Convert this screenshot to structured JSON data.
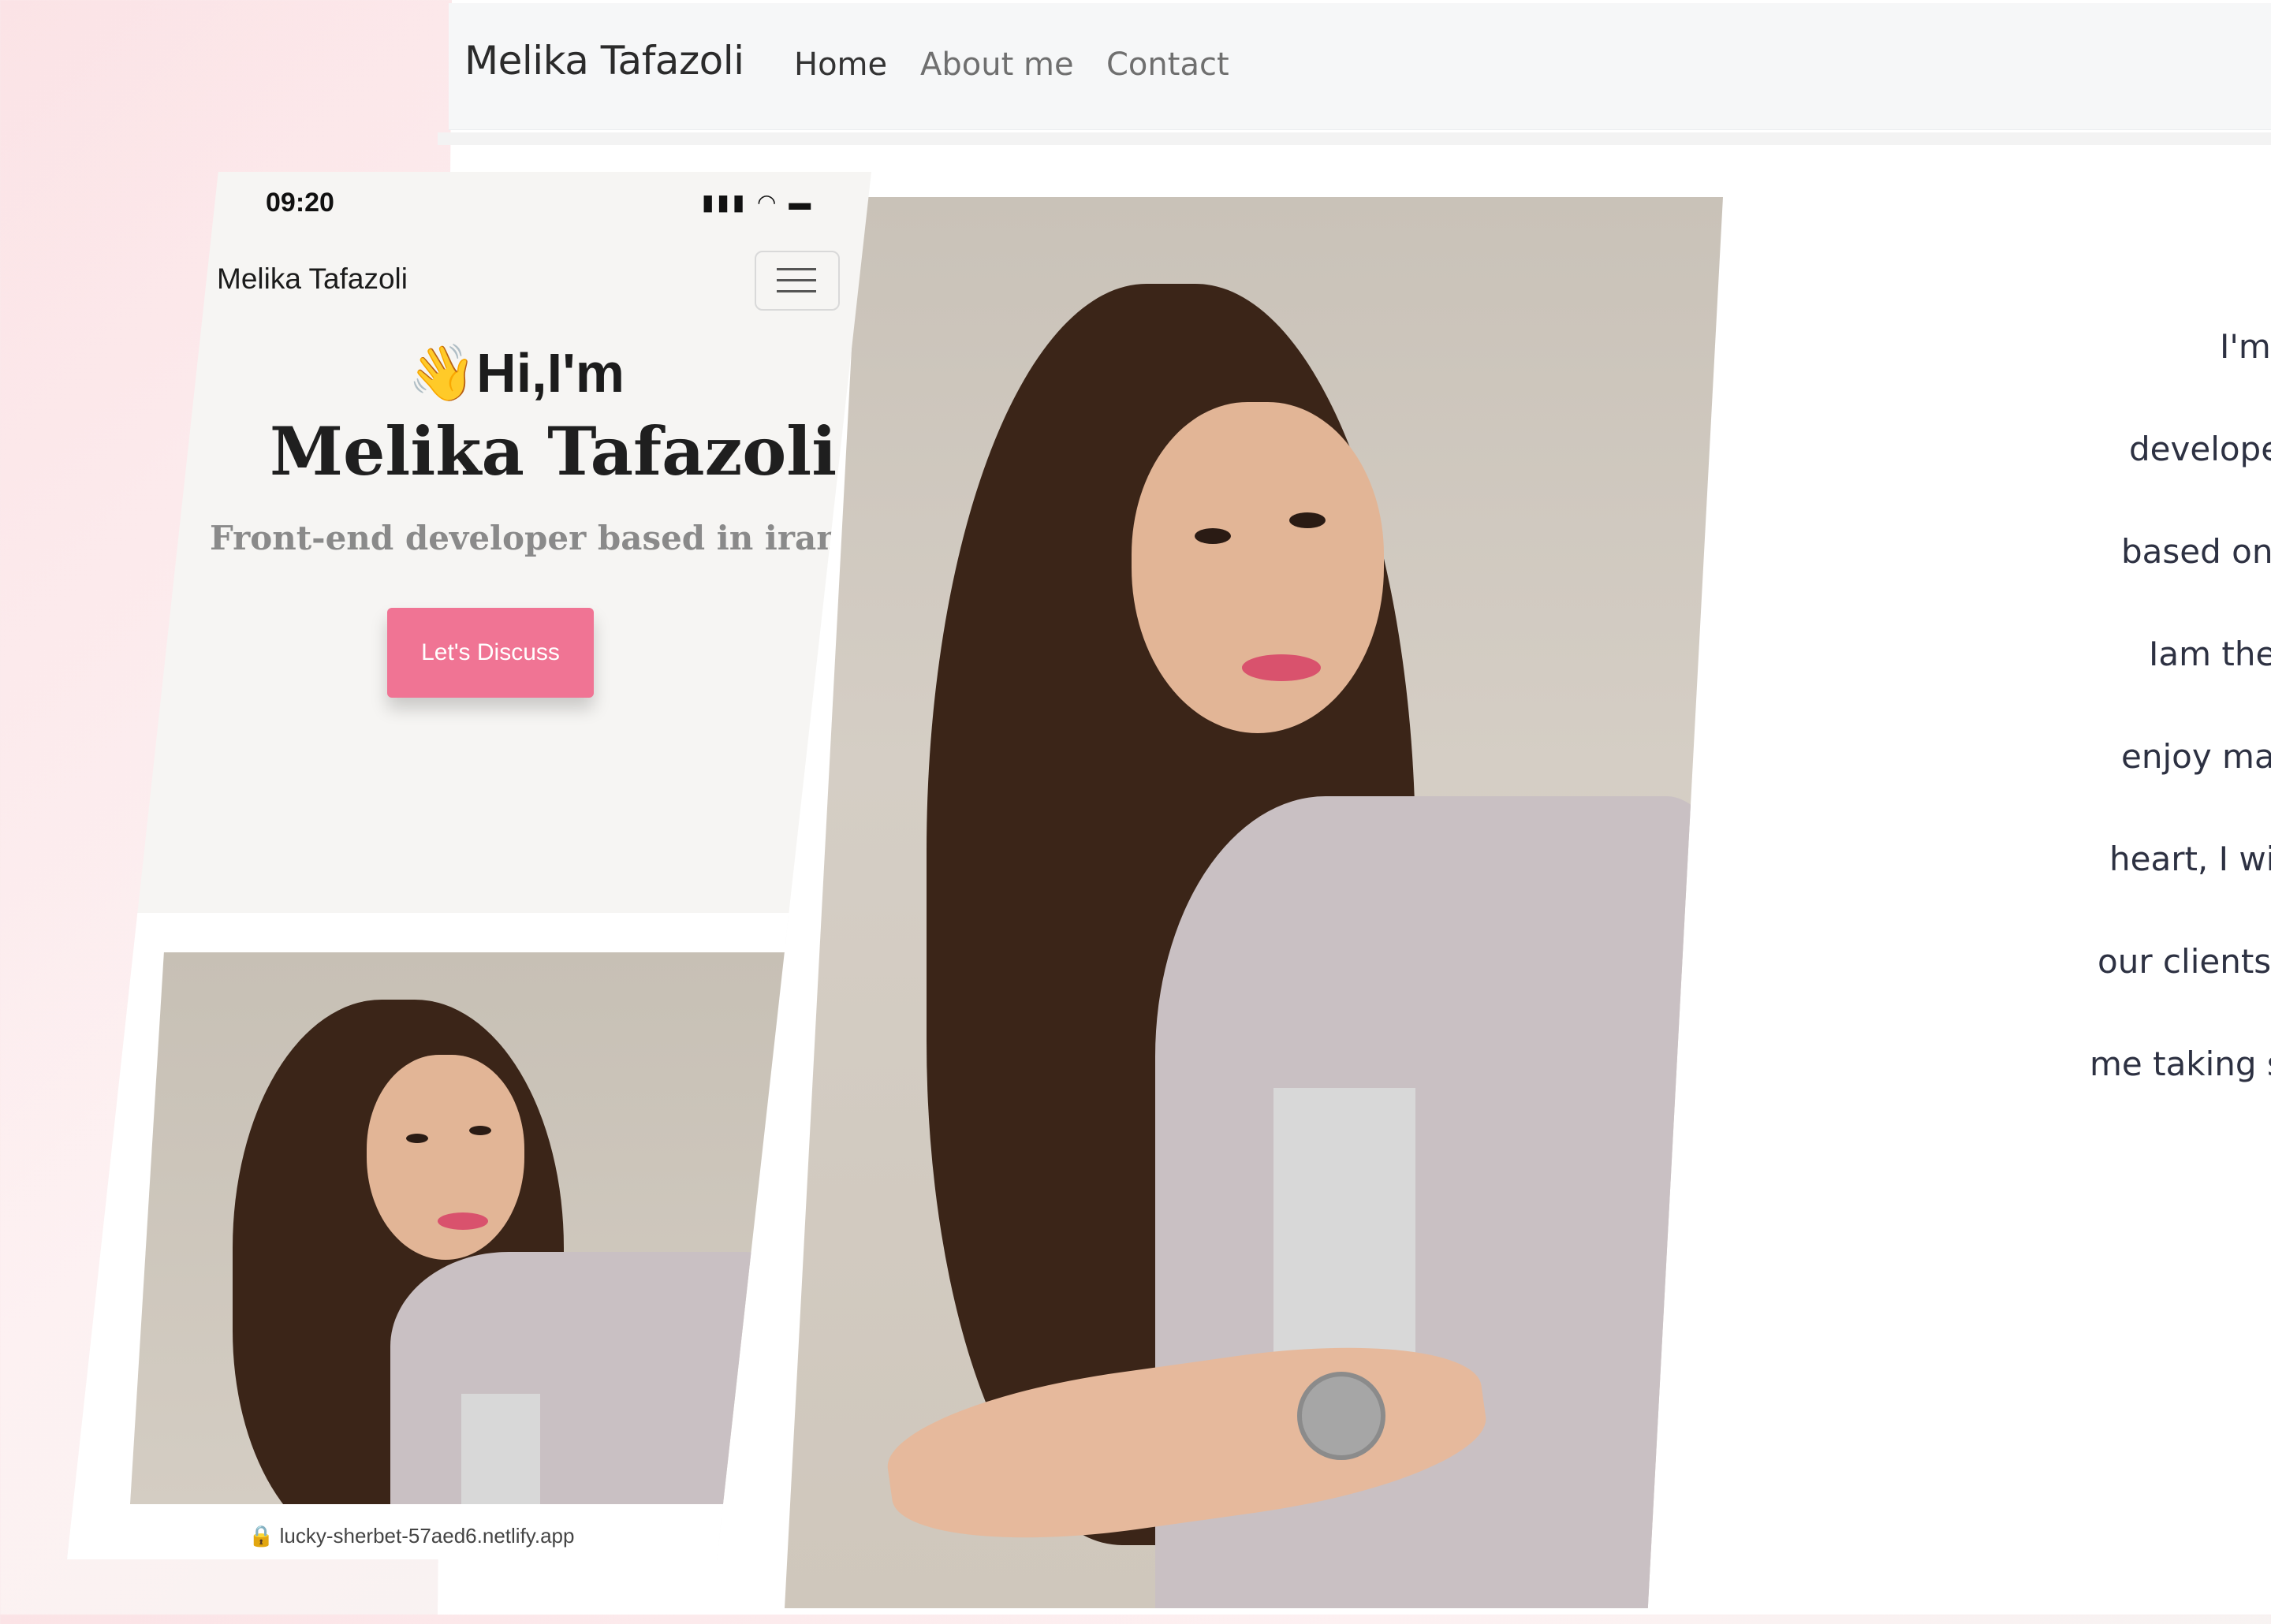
{
  "desktop": {
    "brand": "Melika Tafazoli",
    "nav": [
      {
        "label": "Home"
      },
      {
        "label": "About me"
      },
      {
        "label": "Contact"
      }
    ],
    "about_lines": [
      "I'm t",
      "developer,pr",
      "based on clie",
      "Iam the rigl",
      "enjoy making",
      "heart, I will be",
      "our clients, no r",
      "me taking some"
    ]
  },
  "mobile": {
    "status_time": "09:20",
    "brand": "Melika Tafazoli",
    "greeting": "Hi,I'm",
    "wave_emoji": "👋",
    "name": "Melika Tafazoli",
    "subtitle": "Front-end developer based in iran",
    "cta_label": "Let's Discuss",
    "url": "lucky-sherbet-57aed6.netlify.app"
  },
  "colors": {
    "accent": "#f07494",
    "background": "#fbe3e6"
  }
}
